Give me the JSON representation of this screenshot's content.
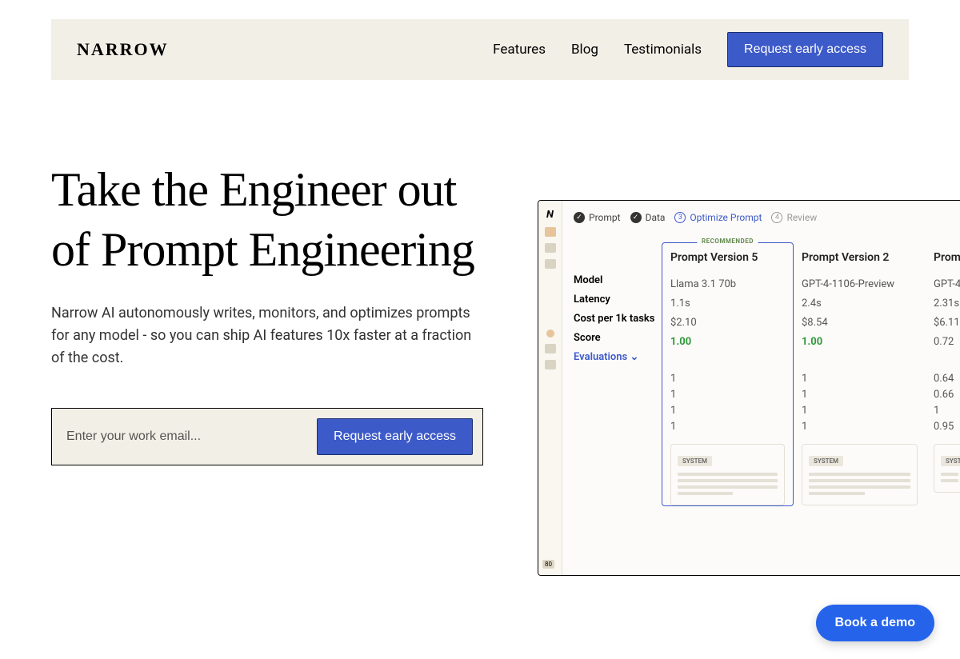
{
  "header": {
    "logo": "NARROW",
    "nav": {
      "features": "Features",
      "blog": "Blog",
      "testimonials": "Testimonials"
    },
    "cta": "Request early access"
  },
  "hero": {
    "title": "Take the Engineer out of Prompt Engineering",
    "subtitle": "Narrow AI autonomously writes, monitors, and optimizes prompts for any model - so you can ship AI features 10x faster at a fraction of the cost.",
    "email_placeholder": "Enter your work email...",
    "email_cta": "Request early access"
  },
  "dashboard": {
    "crumbs": {
      "c1": "Prompt",
      "c2": "Data",
      "c3": "Optimize Prompt",
      "c4": "Review",
      "n3": "3",
      "n4": "4"
    },
    "labels": {
      "model": "Model",
      "latency": "Latency",
      "cost": "Cost per 1k tasks",
      "score": "Score",
      "evaluations": "Evaluations ⌄"
    },
    "recommended": "RECOMMENDED",
    "system_label": "SYSTEM",
    "versions": [
      {
        "title": "Prompt Version 5",
        "model": "Llama 3.1 70b",
        "latency": "1.1s",
        "cost": "$2.10",
        "score": "1.00",
        "evals": [
          "1",
          "1",
          "1",
          "1"
        ]
      },
      {
        "title": "Prompt Version 2",
        "model": "GPT-4-1106-Preview",
        "latency": "2.4s",
        "cost": "$8.54",
        "score": "1.00",
        "evals": [
          "1",
          "1",
          "1",
          "1"
        ]
      },
      {
        "title": "Promp",
        "model": "GPT-4",
        "latency": "2.31s",
        "cost": "$6.11",
        "score": "0.72",
        "evals": [
          "0.64",
          "0.66",
          "1",
          "0.95"
        ]
      }
    ],
    "side_badge": "80"
  },
  "demo_button": "Book a demo"
}
